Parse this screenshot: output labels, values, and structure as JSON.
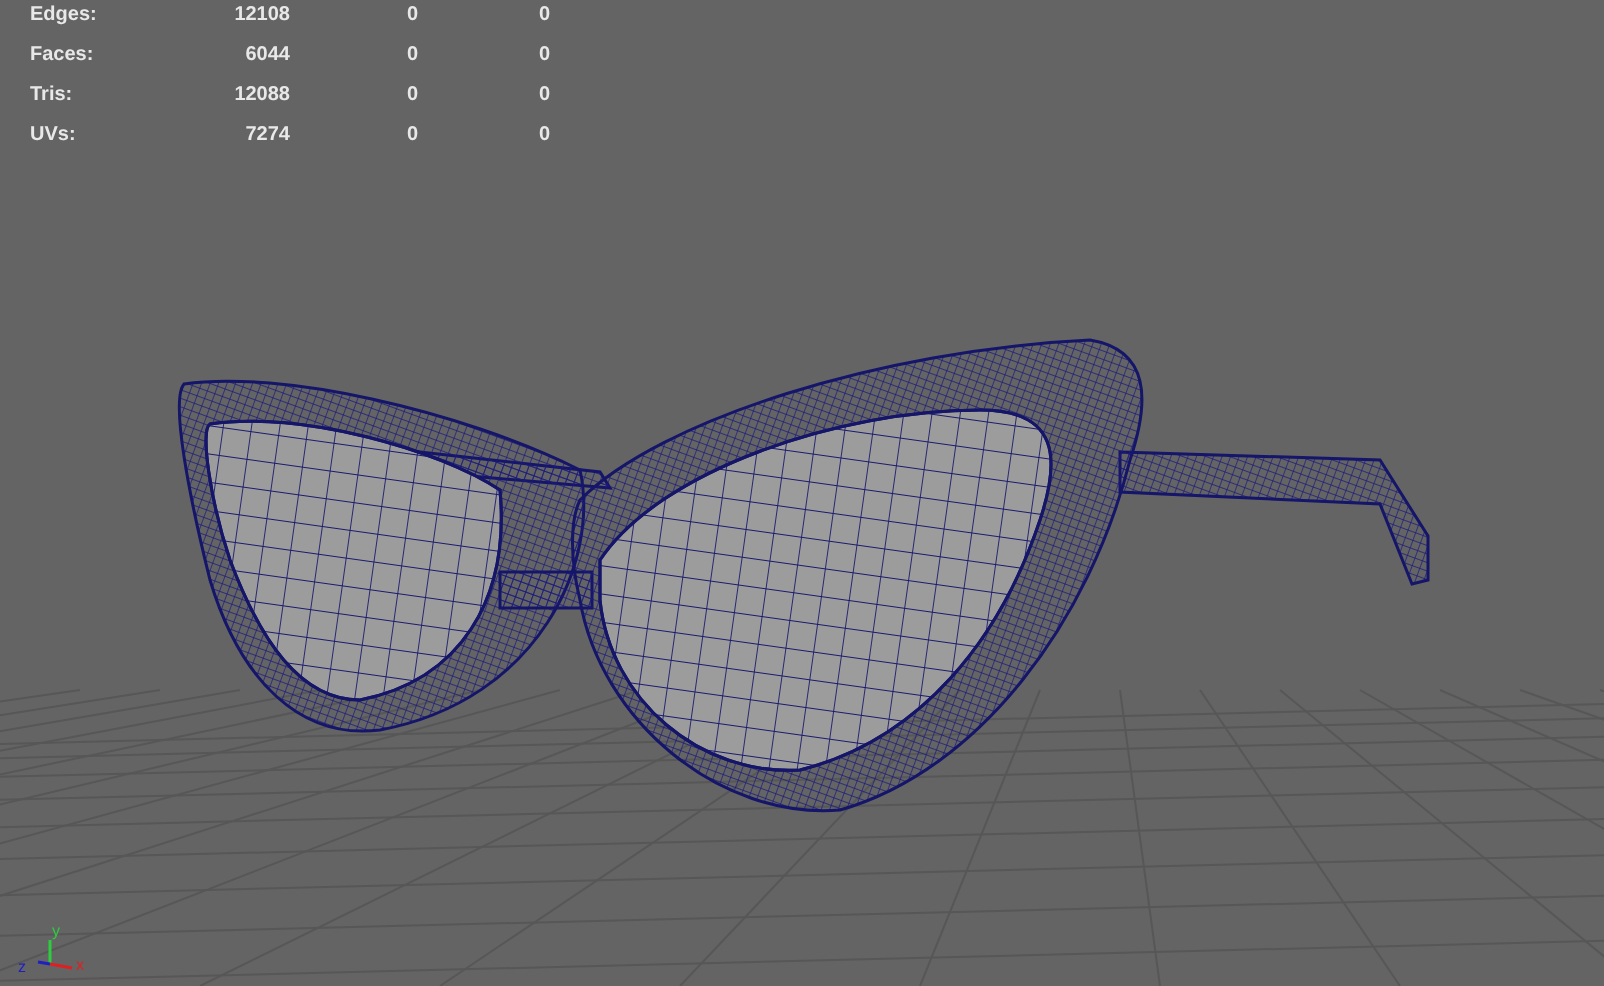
{
  "stats": [
    {
      "label": "Edges:",
      "value": "12108",
      "column_3": "0",
      "column_4": "0"
    },
    {
      "label": "Faces:",
      "value": "6044",
      "column_3": "0",
      "column_4": "0"
    },
    {
      "label": "Tris:",
      "value": "12088",
      "column_3": "0",
      "column_4": "0"
    },
    {
      "label": "UVs:",
      "value": "7274",
      "column_3": "0",
      "column_4": "0"
    }
  ],
  "axes": [
    {
      "kind": "y",
      "label": "y"
    },
    {
      "kind": "z",
      "label": "z"
    },
    {
      "kind": "x",
      "label": "x"
    }
  ]
}
